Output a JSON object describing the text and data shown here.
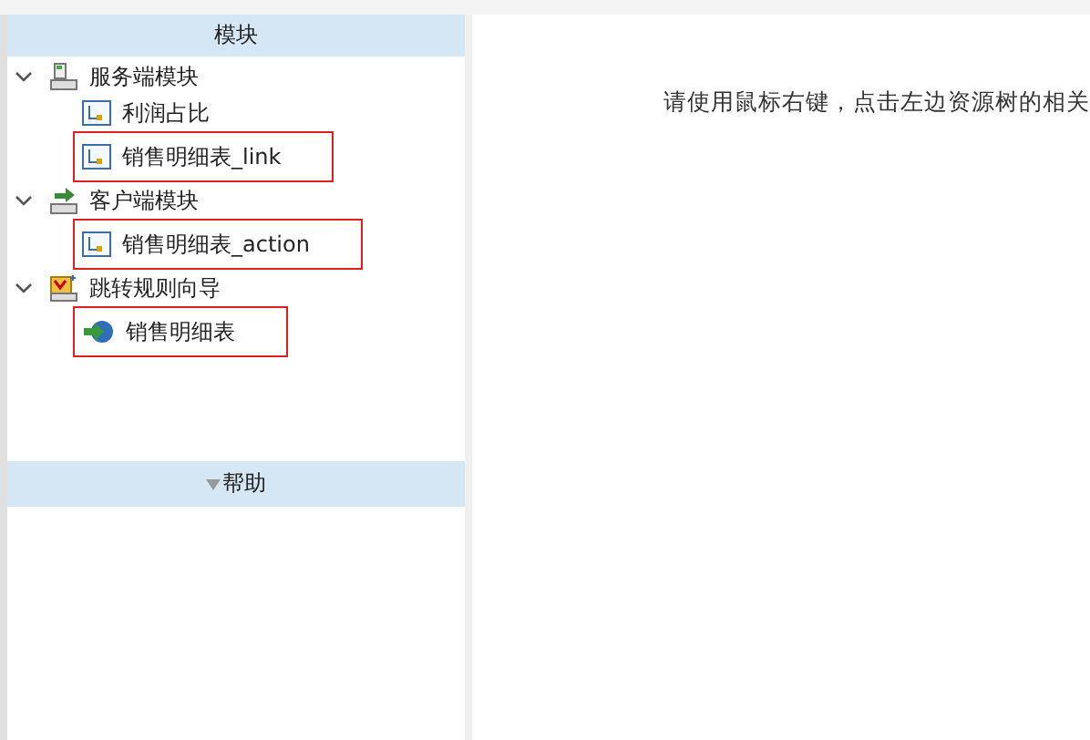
{
  "sidebar": {
    "title": "模块",
    "tree": [
      {
        "label": "服务端模块",
        "kind": "server",
        "expanded": true,
        "highlighted": false,
        "children": [
          {
            "label": "利润占比",
            "kind": "report",
            "highlighted": false
          },
          {
            "label": "销售明细表_link",
            "kind": "report",
            "highlighted": true
          }
        ]
      },
      {
        "label": "客户端模块",
        "kind": "client",
        "expanded": true,
        "highlighted": false,
        "children": [
          {
            "label": "销售明细表_action",
            "kind": "report",
            "highlighted": true
          }
        ]
      },
      {
        "label": "跳转规则向导",
        "kind": "wizard",
        "expanded": true,
        "highlighted": false,
        "children": [
          {
            "label": "销售明细表",
            "kind": "jump",
            "highlighted": true
          }
        ]
      }
    ],
    "help_title": "帮助"
  },
  "main": {
    "message": "请使用鼠标右键，点击左边资源树的相关"
  }
}
